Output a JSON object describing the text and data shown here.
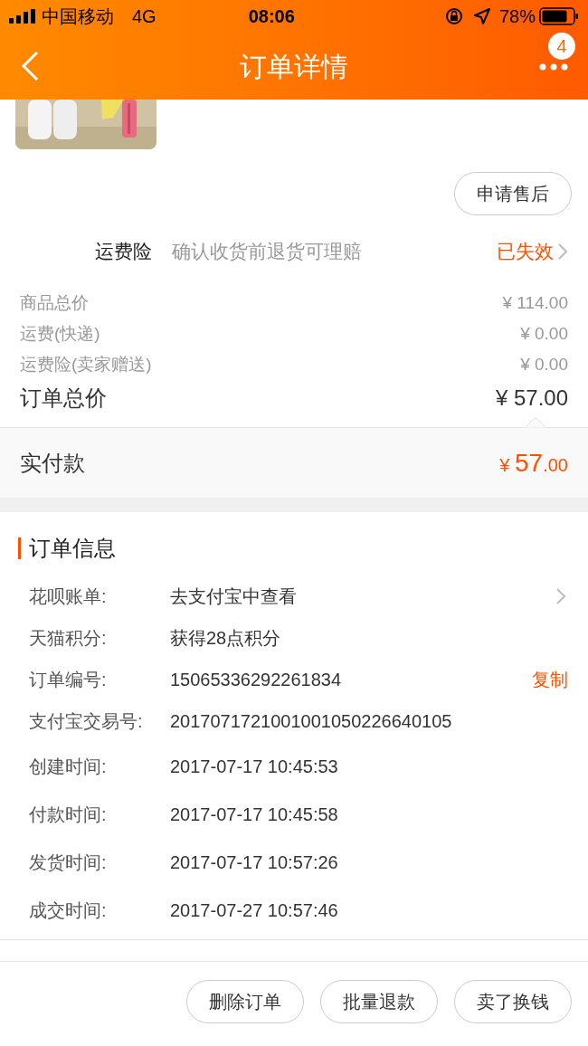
{
  "status_bar": {
    "carrier": "中国移动",
    "network": "4G",
    "time": "08:06",
    "battery": "78%"
  },
  "nav": {
    "title": "订单详情",
    "badge": "4"
  },
  "product": {
    "kind": "picture"
  },
  "after_sale_button": "申请售后",
  "insurance": {
    "label": "运费险",
    "description": "确认收货前退货可理赔",
    "status": "已失效"
  },
  "prices": [
    {
      "label": "商品总价",
      "value": "¥ 114.00",
      "kind": "minor"
    },
    {
      "label": "运费(快递)",
      "value": "¥ 0.00",
      "kind": "minor"
    },
    {
      "label": "运费险(卖家赠送)",
      "value": "¥ 0.00",
      "kind": "minor"
    },
    {
      "label": "订单总价",
      "value": "¥ 57.00",
      "kind": "total"
    }
  ],
  "paid": {
    "label": "实付款",
    "currency": "¥",
    "integer": "57",
    "decimal": ".00"
  },
  "order_info": {
    "title": "订单信息",
    "rows": [
      {
        "label": "花呗账单:",
        "value": "去支付宝中查看",
        "kind": "link"
      },
      {
        "label": "天猫积分:",
        "value": "获得28点积分",
        "kind": "plain"
      },
      {
        "label": "订单编号:",
        "value": "15065336292261834",
        "kind": "copy",
        "action": "复制"
      },
      {
        "label": "支付宝交易号:",
        "value": "2017071721001001050226640105",
        "kind": "plain"
      },
      {
        "label": "创建时间:",
        "value": "2017-07-17 10:45:53",
        "kind": "plain"
      },
      {
        "label": "付款时间:",
        "value": "2017-07-17 10:45:58",
        "kind": "plain"
      },
      {
        "label": "发货时间:",
        "value": "2017-07-17 10:57:26",
        "kind": "plain"
      },
      {
        "label": "成交时间:",
        "value": "2017-07-27 10:57:46",
        "kind": "plain"
      }
    ]
  },
  "bottom_buttons": [
    "删除订单",
    "批量退款",
    "卖了换钱"
  ]
}
